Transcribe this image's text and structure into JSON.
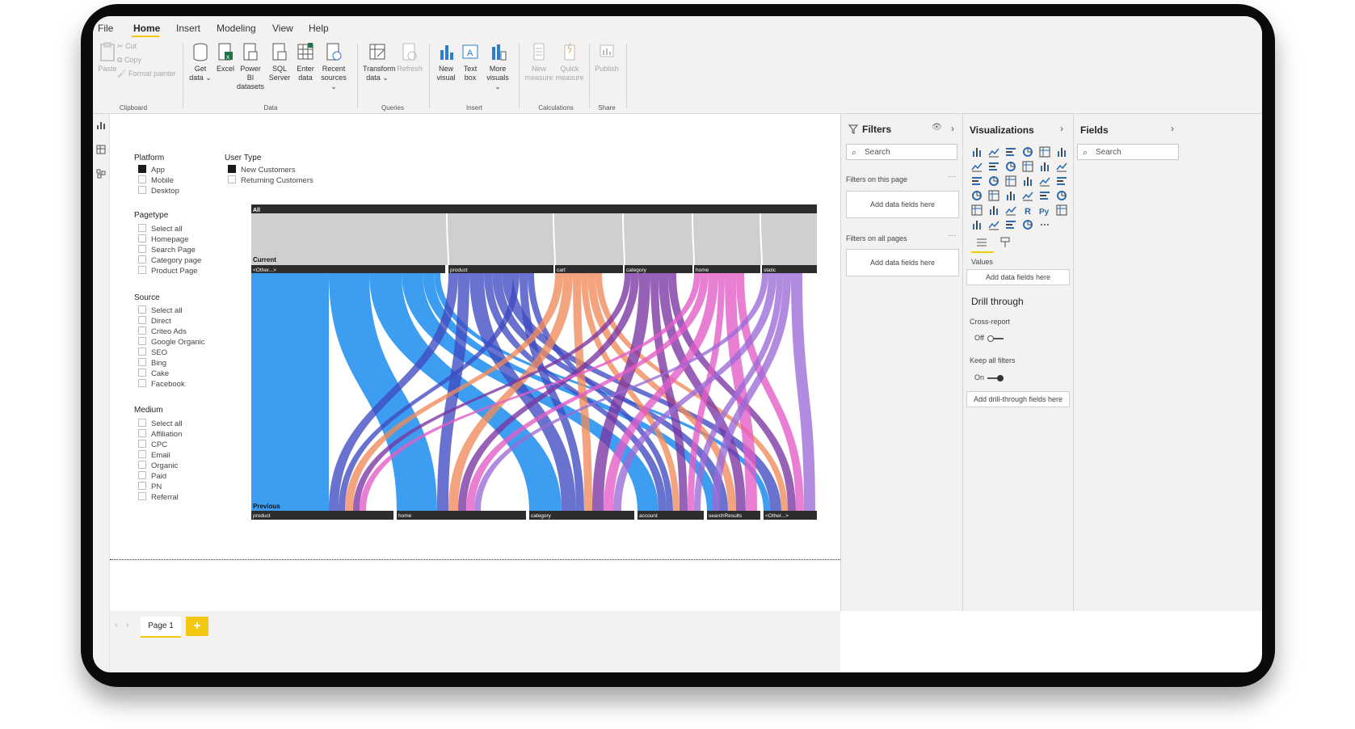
{
  "menu": {
    "items": [
      "File",
      "Home",
      "Insert",
      "Modeling",
      "View",
      "Help"
    ],
    "active": "Home"
  },
  "ribbon": {
    "clipboard": {
      "paste": "Paste",
      "cut": "Cut",
      "copy": "Copy",
      "format_painter": "Format painter",
      "group": "Clipboard"
    },
    "data": {
      "get_data": [
        "Get",
        "data ⌄"
      ],
      "excel": [
        "Excel"
      ],
      "power_bi": [
        "Power BI",
        "datasets"
      ],
      "sql": [
        "SQL",
        "Server"
      ],
      "enter": [
        "Enter",
        "data"
      ],
      "recent": [
        "Recent",
        "sources ⌄"
      ],
      "group": "Data"
    },
    "queries": {
      "transform": [
        "Transform",
        "data ⌄"
      ],
      "refresh": [
        "Refresh"
      ],
      "group": "Queries"
    },
    "insert": {
      "new_visual": [
        "New",
        "visual"
      ],
      "text_box": [
        "Text",
        "box"
      ],
      "more_visuals": [
        "More",
        "visuals ⌄"
      ],
      "group": "Insert"
    },
    "calculations": {
      "new_measure": [
        "New",
        "measure"
      ],
      "quick_measure": [
        "Quick",
        "measure"
      ],
      "group": "Calculations"
    },
    "share": {
      "publish": [
        "Publish"
      ],
      "group": "Share"
    }
  },
  "slicers": {
    "platform": {
      "title": "Platform",
      "items": [
        {
          "label": "App",
          "checked": true
        },
        {
          "label": "Mobile",
          "checked": false
        },
        {
          "label": "Desktop",
          "checked": false
        }
      ]
    },
    "user_type": {
      "title": "User Type",
      "items": [
        {
          "label": "New Customers",
          "checked": true
        },
        {
          "label": "Returning Customers",
          "checked": false
        }
      ]
    },
    "pagetype": {
      "title": "Pagetype",
      "items": [
        {
          "label": "Select all"
        },
        {
          "label": "Homepage"
        },
        {
          "label": "Search Page"
        },
        {
          "label": "Category page"
        },
        {
          "label": "Product Page"
        }
      ]
    },
    "source": {
      "title": "Source",
      "items": [
        {
          "label": "Select all"
        },
        {
          "label": "Direct"
        },
        {
          "label": "Criteo Ads"
        },
        {
          "label": "Google Organic"
        },
        {
          "label": "SEO"
        },
        {
          "label": "Bing"
        },
        {
          "label": "Cake"
        },
        {
          "label": "Facebook"
        }
      ]
    },
    "medium": {
      "title": "Medium",
      "items": [
        {
          "label": "Select all"
        },
        {
          "label": "Affiliation"
        },
        {
          "label": "CPC"
        },
        {
          "label": "Email"
        },
        {
          "label": "Organic"
        },
        {
          "label": "Paid"
        },
        {
          "label": "PN"
        },
        {
          "label": "Referral"
        }
      ]
    }
  },
  "sankey": {
    "top_label": "All",
    "current_label": "Current",
    "previous_label": "Previous",
    "current_nodes": [
      "<Other...>",
      "product",
      "cart",
      "category",
      "home",
      "static"
    ],
    "previous_nodes": [
      "product",
      "home",
      "category",
      "account",
      "searchResults",
      "<Other...>"
    ],
    "colors": {
      "<Other...>": "#3399f0",
      "product": "#3f4ac0",
      "cart": "#ef8a5a",
      "category": "#7a35a3",
      "home": "#e35bc6",
      "static": "#9a6ad6"
    }
  },
  "filters": {
    "title": "Filters",
    "search_placeholder": "Search",
    "on_this_page": "Filters on this page",
    "on_all_pages": "Filters on all pages",
    "add_fields": "Add data fields here"
  },
  "visualizations": {
    "title": "Visualizations",
    "values_label": "Values",
    "add_fields": "Add data fields here",
    "drill_through": "Drill through",
    "cross_report": "Cross-report",
    "cross_report_state": "Off",
    "keep_all_filters": "Keep all filters",
    "keep_all_filters_state": "On",
    "add_drill_fields": "Add drill-through fields here",
    "icons": [
      "stacked-bar-icon",
      "stacked-column-icon",
      "clustered-bar-icon",
      "clustered-column-icon",
      "100-bar-icon",
      "100-column-icon",
      "line-chart-icon",
      "area-chart-icon",
      "stacked-area-icon",
      "line-column-icon",
      "line-clustered-icon",
      "ribbon-chart-icon",
      "waterfall-icon",
      "funnel-icon",
      "scatter-icon",
      "pie-chart-icon",
      "donut-icon",
      "treemap-icon",
      "map-icon",
      "filled-map-icon",
      "gauge-icon",
      "card-icon",
      "multirow-card-icon",
      "kpi-icon",
      "slicer-icon",
      "table-icon",
      "matrix-icon",
      "r-visual-icon",
      "python-visual-icon",
      "key-influencers-icon",
      "decomposition-tree-icon",
      "qa-icon",
      "smart-narrative-icon",
      "paginated-icon",
      "more-visuals-icon"
    ]
  },
  "fields": {
    "title": "Fields",
    "search_placeholder": "Search"
  },
  "pages": {
    "tabs": [
      "Page 1"
    ],
    "add": "+"
  }
}
